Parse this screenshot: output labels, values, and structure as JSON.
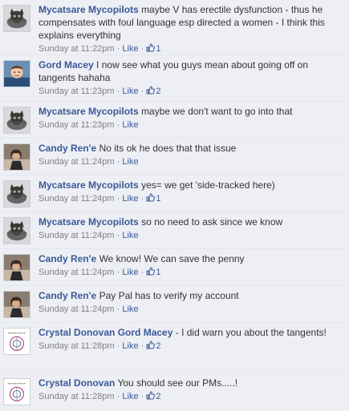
{
  "comments": [
    {
      "author": "Mycatsare Mycopilots",
      "avatar": "cat-avatar",
      "mention": "",
      "text": "maybe V has erectile dysfunction - thus he compensates with foul language esp directed a women - I think this explains everything",
      "time": "Sunday at 11:22pm",
      "like_label": "Like",
      "likes": "1"
    },
    {
      "author": "Gord Macey",
      "avatar": "child-photo-avatar",
      "mention": "",
      "text": "I now see what you guys mean about going off on tangents hahaha",
      "time": "Sunday at 11:23pm",
      "like_label": "Like",
      "likes": "2"
    },
    {
      "author": "Mycatsare Mycopilots",
      "avatar": "cat-avatar",
      "mention": "",
      "text": "maybe we don't want to go into that",
      "time": "Sunday at 11:23pm",
      "like_label": "Like",
      "likes": ""
    },
    {
      "author": "Candy Ren'e",
      "avatar": "person-photo-avatar",
      "mention": "",
      "text": "No its ok he does that that issue",
      "time": "Sunday at 11:24pm",
      "like_label": "Like",
      "likes": ""
    },
    {
      "author": "Mycatsare Mycopilots",
      "avatar": "cat-avatar",
      "mention": "",
      "text": "yes= we get 'side-tracked here)",
      "time": "Sunday at 11:24pm",
      "like_label": "Like",
      "likes": "1"
    },
    {
      "author": "Mycatsare Mycopilots",
      "avatar": "cat-avatar",
      "mention": "",
      "text": "so no need to ask since we know",
      "time": "Sunday at 11:24pm",
      "like_label": "Like",
      "likes": ""
    },
    {
      "author": "Candy Ren'e",
      "avatar": "person-photo-avatar",
      "mention": "",
      "text": "We know! We can save the penny",
      "time": "Sunday at 11:24pm",
      "like_label": "Like",
      "likes": "1"
    },
    {
      "author": "Candy Ren'e",
      "avatar": "person-photo-avatar",
      "mention": "",
      "text": "Pay Pal has to verify my account",
      "time": "Sunday at 11:24pm",
      "like_label": "Like",
      "likes": ""
    },
    {
      "author": "Crystal Donovan",
      "avatar": "logo-avatar",
      "mention": "Gord Macey",
      "text": "- I did warn you about the tangents!",
      "time": "Sunday at 11:28pm",
      "like_label": "Like",
      "likes": "2"
    },
    {
      "author": "Crystal Donovan",
      "avatar": "logo-avatar",
      "mention": "",
      "text": "You should see our PMs.....!",
      "time": "Sunday at 11:28pm",
      "like_label": "Like",
      "likes": "2"
    }
  ],
  "meta_separator": "·",
  "colors": {
    "background": "#edeff4",
    "link": "#3b5998",
    "meta": "#808080",
    "text": "#333333"
  }
}
